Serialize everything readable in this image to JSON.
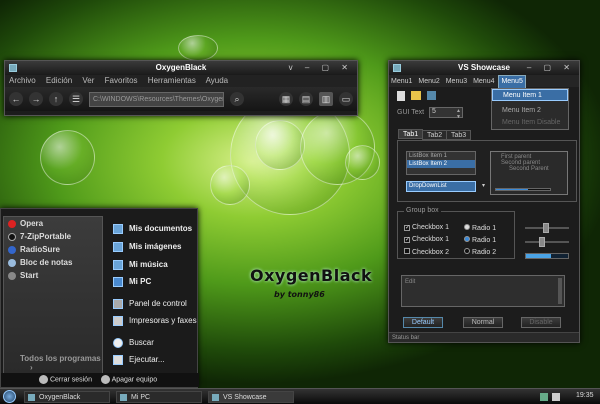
{
  "explorer": {
    "title": "OxygenBlack",
    "controls": "v – ▢ ✕",
    "menu": [
      "Archivo",
      "Edición",
      "Ver",
      "Favoritos",
      "Herramientas",
      "Ayuda"
    ],
    "address": "C:\\WINDOWS\\Resources\\Themes\\OxygenBlack"
  },
  "vs": {
    "title": "VS Showcase",
    "controls": "– ▢ ✕",
    "menu": [
      "Menu1",
      "Menu2",
      "Menu3",
      "Menu4",
      "Menu5"
    ],
    "dropdown": [
      "Menu Item 1",
      "Menu Item 2",
      "Menu Item Disable"
    ],
    "gui_text_label": "GUI Text",
    "gui_text_value": "5",
    "tabs": [
      "Tab1",
      "Tab2",
      "Tab3"
    ],
    "listbox": [
      "ListBox Item 1",
      "ListBox Item 2"
    ],
    "dropdown_list": "DropDownList",
    "tree": [
      "First parent",
      "Second parent",
      "Second Parent"
    ],
    "group_label": "Group box",
    "checkboxes": [
      "Checkbox 1",
      "Checkbox 1",
      "Checkbox 2"
    ],
    "radios": [
      "Radio 1",
      "Radio 1",
      "Radio 2"
    ],
    "edit_text": "Edit",
    "buttons": [
      "Default",
      "Normal",
      "Disable"
    ],
    "status": "Status bar"
  },
  "start": {
    "left_items": [
      "Opera",
      "7-ZipPortable",
      "RadioSure",
      "Bloc de notas",
      "Start"
    ],
    "all_programs": "Todos los programas",
    "right_items": [
      "Mis documentos",
      "Mis imágenes",
      "Mi música",
      "Mi PC",
      "Panel de control",
      "Impresoras y faxes",
      "Buscar",
      "Ejecutar..."
    ],
    "logoff": "Cerrar sesión",
    "shutdown": "Apagar equipo"
  },
  "desktop": {
    "brand": "OxygenBlack",
    "byline": "by tonny86"
  },
  "taskbar": {
    "tasks": [
      "OxygenBlack",
      "Mi PC",
      "VS Showcase"
    ],
    "clock": "19:35"
  }
}
